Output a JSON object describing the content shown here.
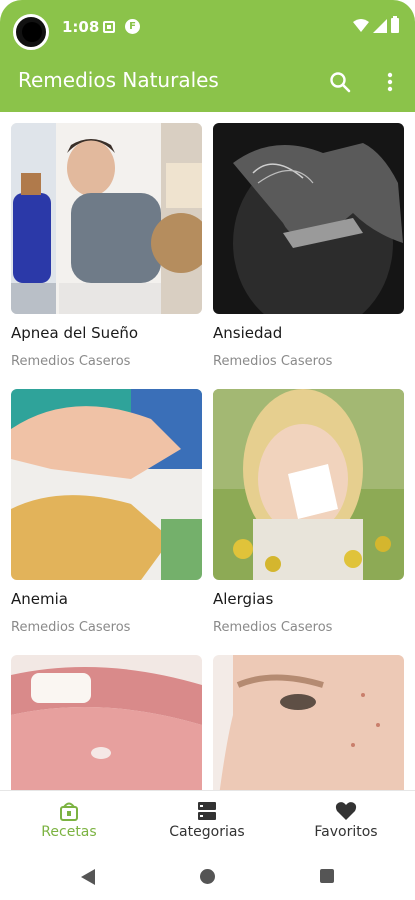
{
  "status_bar": {
    "time": "1:08",
    "notif_app_letter": "F"
  },
  "app_bar": {
    "title": "Remedios Naturales",
    "search_icon": "search-icon",
    "menu_icon": "more-vert-icon"
  },
  "cards": [
    {
      "title": "Apnea del Sueño",
      "subtitle": "Remedios Caseros"
    },
    {
      "title": "Ansiedad",
      "subtitle": "Remedios Caseros"
    },
    {
      "title": "Anemia",
      "subtitle": "Remedios Caseros"
    },
    {
      "title": "Alergias",
      "subtitle": "Remedios Caseros"
    },
    {
      "title": "",
      "subtitle": ""
    },
    {
      "title": "",
      "subtitle": ""
    }
  ],
  "bottom_nav": [
    {
      "label": "Recetas",
      "icon": "recipe-icon",
      "active": true
    },
    {
      "label": "Categorias",
      "icon": "categories-icon",
      "active": false
    },
    {
      "label": "Favoritos",
      "icon": "heart-icon",
      "active": false
    }
  ],
  "colors": {
    "primary": "#8BC34A",
    "active_nav": "#7CB342",
    "subtitle": "#8A8A8A"
  }
}
